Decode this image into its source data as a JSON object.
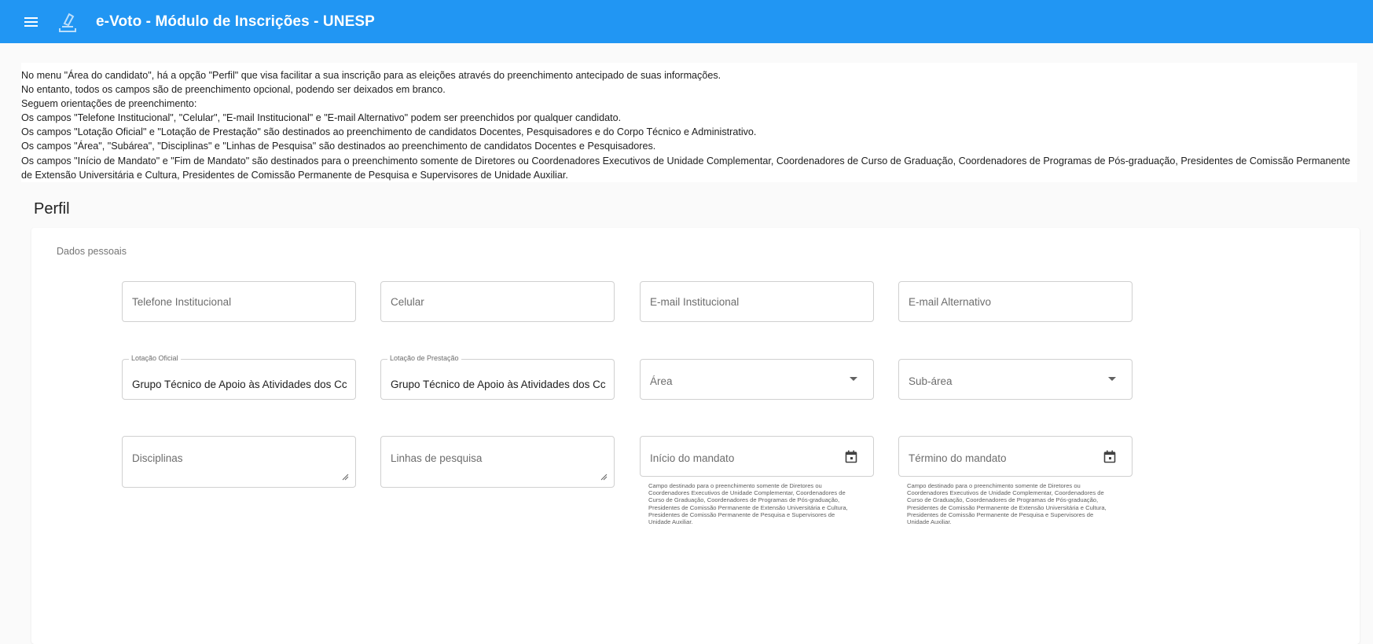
{
  "header": {
    "title": "e-Voto - Módulo de Inscrições - UNESP",
    "menu_icon": "menu-icon",
    "logo_icon": "ballot-logo-icon",
    "color": "#2196f3"
  },
  "intro": {
    "lines": [
      "No menu \"Área do candidato\", há a opção \"Perfil\" que visa facilitar a sua inscrição para as eleições através do preenchimento antecipado de suas informações.",
      "No entanto, todos os campos são de preenchimento opcional, podendo ser deixados em branco.",
      "Seguem orientações de preenchimento:",
      "Os campos \"Telefone Institucional\", \"Celular\", \"E-mail Institucional\" e \"E-mail Alternativo\" podem ser preenchidos por qualquer candidato.",
      "Os campos \"Lotação Oficial\" e \"Lotação de Prestação\" são destinados ao preenchimento de candidatos Docentes, Pesquisadores e do Corpo Técnico e Administrativo.",
      "Os campos \"Área\", \"Subárea\", \"Disciplinas\" e \"Linhas de Pesquisa\" são destinados ao preenchimento de candidatos Docentes e Pesquisadores.",
      "Os campos \"Início de Mandato\" e \"Fim de Mandato\" são destinados para o preenchimento somente de Diretores ou Coordenadores Executivos de Unidade Complementar, Coordenadores de Curso de Graduação, Coordenadores de Programas de Pós-graduação, Presidentes de Comissão Permanente de Extensão Universitária e Cultura, Presidentes de Comissão Permanente de Pesquisa e Supervisores de Unidade Auxiliar."
    ]
  },
  "profile": {
    "title": "Perfil",
    "section_label": "Dados pessoais",
    "fields": {
      "telefone": {
        "placeholder": "Telefone Institucional",
        "value": ""
      },
      "celular": {
        "placeholder": "Celular",
        "value": ""
      },
      "email_inst": {
        "placeholder": "E-mail Institucional",
        "value": ""
      },
      "email_alt": {
        "placeholder": "E-mail Alternativo",
        "value": ""
      },
      "lotacao_oficial": {
        "label": "Lotação Oficial",
        "value": "Grupo Técnico de Apoio às Atividades dos Cc"
      },
      "lotacao_prestacao": {
        "label": "Lotação de Prestação",
        "value": "Grupo Técnico de Apoio às Atividades dos Cc"
      },
      "area": {
        "placeholder": "Área"
      },
      "subarea": {
        "placeholder": "Sub-área"
      },
      "disciplinas": {
        "placeholder": "Disciplinas"
      },
      "linhas": {
        "placeholder": "Linhas de pesquisa"
      },
      "inicio": {
        "placeholder": "Início do mandato"
      },
      "termino": {
        "placeholder": "Término do mandato"
      }
    },
    "mandate_hint": "Campo destinado para o preenchimento somente de Diretores ou Coordenadores Executivos de Unidade Complementar, Coordenadores de Curso de Graduação, Coordenadores de Programas de Pós-graduação, Presidentes de Comissão Permanente de Extensão Universitária e Cultura, Presidentes de Comissão Permanente de Pesquisa e Supervisores de Unidade Auxiliar."
  }
}
